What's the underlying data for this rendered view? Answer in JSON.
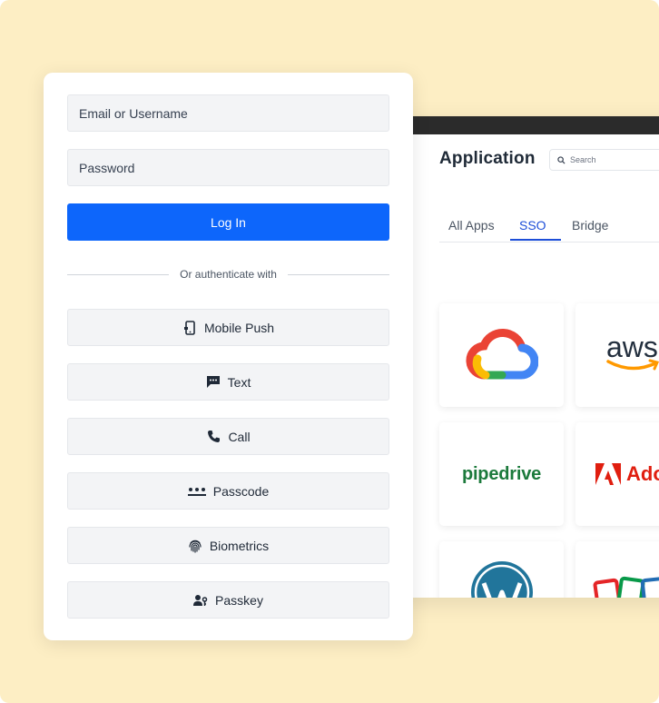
{
  "login": {
    "email_placeholder": "Email or Username",
    "password_placeholder": "Password",
    "login_label": "Log In",
    "divider_text": "Or authenticate with",
    "methods": [
      {
        "label": "Mobile Push",
        "icon": "mobile-push-icon"
      },
      {
        "label": "Text",
        "icon": "chat-bubble-icon"
      },
      {
        "label": "Call",
        "icon": "phone-icon"
      },
      {
        "label": "Passcode",
        "icon": "passcode-dots-icon"
      },
      {
        "label": "Biometrics",
        "icon": "fingerprint-icon"
      },
      {
        "label": "Passkey",
        "icon": "passkey-user-icon"
      }
    ]
  },
  "app": {
    "title": "Application",
    "search_placeholder": "Search",
    "tabs": [
      {
        "label": "All Apps",
        "active": false
      },
      {
        "label": "SSO",
        "active": true
      },
      {
        "label": "Bridge",
        "active": false
      }
    ],
    "cards": [
      {
        "name": "google-cloud-logo",
        "text": ""
      },
      {
        "name": "aws-logo",
        "text": "aws"
      },
      {
        "name": "pipedrive-logo",
        "text": "pipedrive"
      },
      {
        "name": "adobe-logo",
        "text": "Ado"
      },
      {
        "name": "wordpress-logo",
        "text": ""
      },
      {
        "name": "zoho-logo",
        "text": ""
      }
    ]
  },
  "colors": {
    "background": "#fdeec4",
    "primary": "#0d66fb",
    "active_tab": "#1d4ed8"
  }
}
